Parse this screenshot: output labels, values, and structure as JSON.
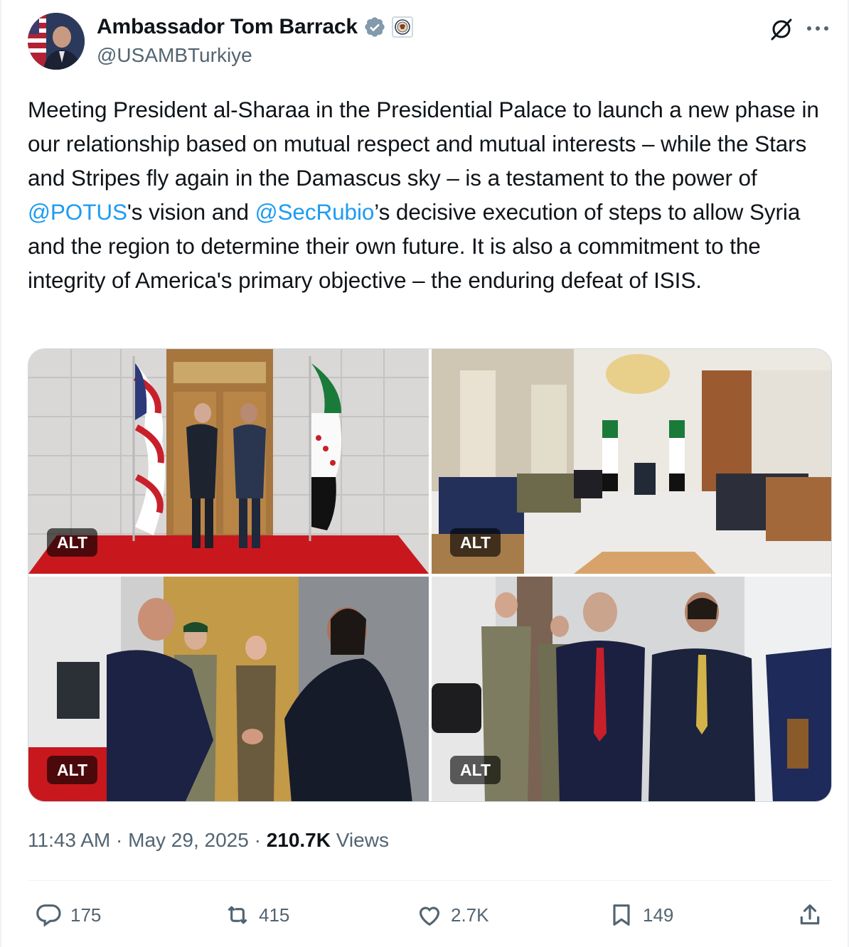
{
  "author": {
    "display_name": "Ambassador Tom Barrack",
    "handle": "@USAMBTurkiye"
  },
  "tweet": {
    "parts": [
      "Meeting President al-Sharaa in the Presidential Palace to launch a new phase in our relationship based on mutual respect and mutual interests – while the Stars and Stripes fly again in the Damascus sky – is a testament to the power of ",
      "@POTUS",
      "'s vision and ",
      "@SecRubio",
      "’s decisive execution of steps to allow Syria and the region to determine their own future. It is also a commitment to the integrity of America's primary objective – the enduring defeat of ISIS."
    ]
  },
  "media": {
    "alt_badges": [
      "ALT",
      "ALT",
      "ALT",
      "ALT"
    ]
  },
  "meta": {
    "time": "11:43 AM",
    "separator": " · ",
    "date": "May 29, 2025",
    "views_count": "210.7K",
    "views_label": "Views"
  },
  "actions": {
    "replies": "175",
    "reposts": "415",
    "likes": "2.7K",
    "bookmarks": "149"
  },
  "colors": {
    "accent": "#1d9bf0",
    "secondary_text": "#536471",
    "primary_text": "#0f1419",
    "verified": "#829aab"
  },
  "icons": [
    "verified-badge-icon",
    "government-affiliation-icon",
    "grok-icon",
    "more-icon",
    "reply-icon",
    "repost-icon",
    "like-icon",
    "bookmark-icon",
    "share-icon"
  ]
}
